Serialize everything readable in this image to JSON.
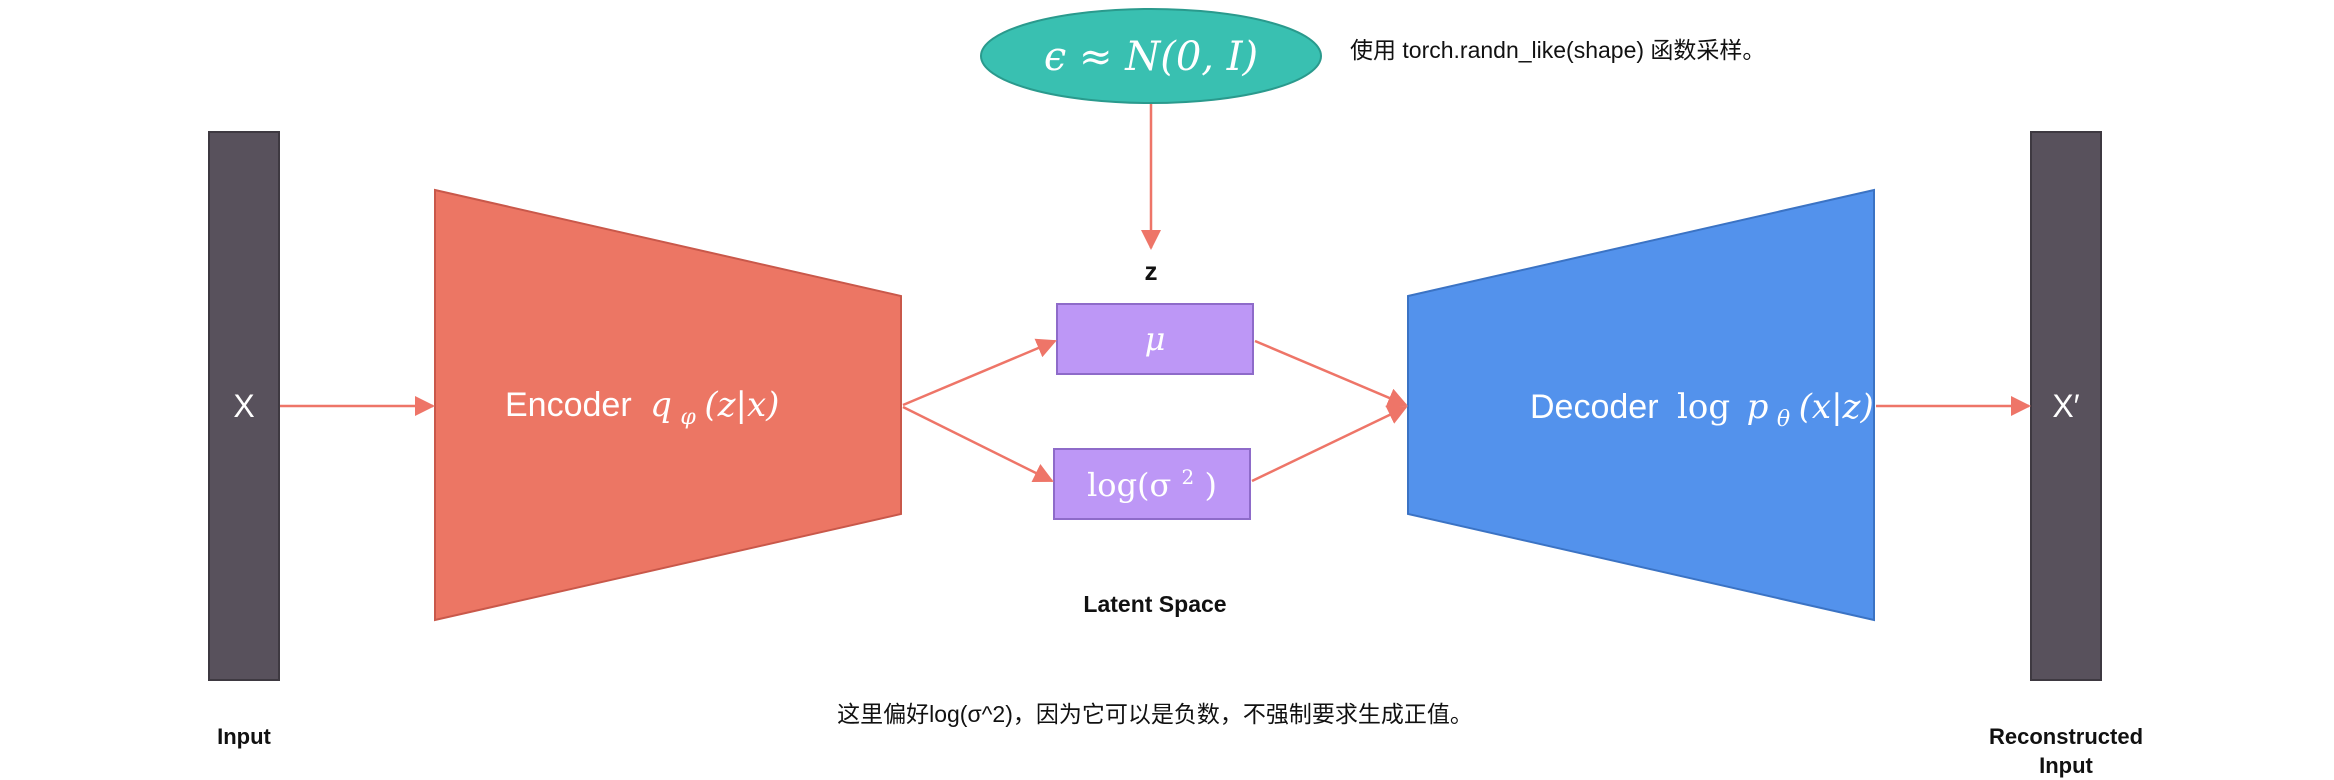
{
  "input_bar": {
    "symbol": "X",
    "caption": "Input"
  },
  "encoder": {
    "word": "Encoder",
    "formula": "qφ(z|x)",
    "q": "q",
    "phi": "φ",
    "args": "(z|x)"
  },
  "noise": {
    "formula": "ϵ ≈ N(0, I)",
    "note": "使用 torch.randn_like(shape) 函数采样。"
  },
  "latent": {
    "z_label": "z",
    "mu": "μ",
    "log_var": "log(σ²)",
    "log_word": "log(σ",
    "sup": "2",
    "close": ")",
    "caption": "Latent Space"
  },
  "decoder": {
    "word": "Decoder",
    "formula": "log pθ(x|z)",
    "log": "log",
    "p": "p",
    "theta": "θ",
    "args": "(x|z)"
  },
  "output_bar": {
    "symbol": "X′",
    "caption_line1": "Reconstructed",
    "caption_line2": "Input"
  },
  "footnote": "这里偏好log(σ^2)，因为它可以是负数，不强制要求生成正值。",
  "colors": {
    "bar": "#58515c",
    "encoder": "#ec7664",
    "decoder": "#5392ec",
    "latent_box": "#bd97f6",
    "latent_stroke": "#8e6bc9",
    "noise": "#39c0b1",
    "noise_stroke": "#2a9a8d",
    "arrow": "#ee7568"
  }
}
